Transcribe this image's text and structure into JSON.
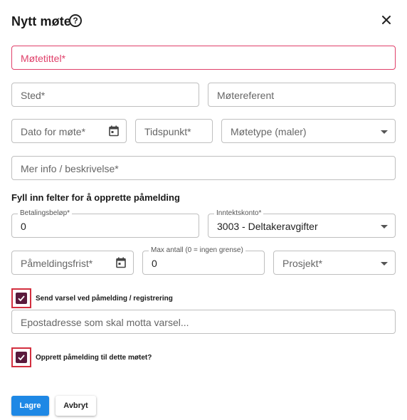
{
  "dialog": {
    "title": "Nytt møte",
    "help_icon": "help-circle-icon",
    "close_icon": "close-icon"
  },
  "fields": {
    "meeting_title": {
      "placeholder": "Møtetittel*",
      "state": "error"
    },
    "location": {
      "placeholder": "Sted*"
    },
    "minute_taker": {
      "placeholder": "Møtereferent"
    },
    "meeting_date": {
      "placeholder": "Dato for møte*",
      "icon": "calendar-icon"
    },
    "time": {
      "placeholder": "Tidspunkt*"
    },
    "meeting_type": {
      "placeholder": "Møtetype (maler)"
    },
    "description": {
      "placeholder": "Mer info / beskrivelse*"
    }
  },
  "registration": {
    "section_title": "Fyll inn felter for å opprette påmelding",
    "fee": {
      "label": "Betalingsbeløp*",
      "value": "0"
    },
    "income_account": {
      "label": "Inntektskonto*",
      "value": "3003 - Deltakeravgifter"
    },
    "deadline": {
      "placeholder": "Påmeldingsfrist*",
      "icon": "calendar-icon"
    },
    "max_count": {
      "label": "Max antall (0 = ingen grense)",
      "value": "0"
    },
    "project": {
      "placeholder": "Prosjekt*"
    },
    "notify_checkbox": {
      "label": "Send varsel ved påmelding / registrering",
      "checked": true
    },
    "notify_email": {
      "placeholder": "Epostadresse som skal motta varsel..."
    },
    "create_checkbox": {
      "label": "Opprett påmelding til dette møtet?",
      "checked": true
    }
  },
  "actions": {
    "save_label": "Lagre",
    "cancel_label": "Avbryt"
  },
  "colors": {
    "primary": "#1e88e5",
    "error": "#e0406a",
    "checkbox": "#5a1a3c",
    "highlight": "#d32f3f"
  }
}
